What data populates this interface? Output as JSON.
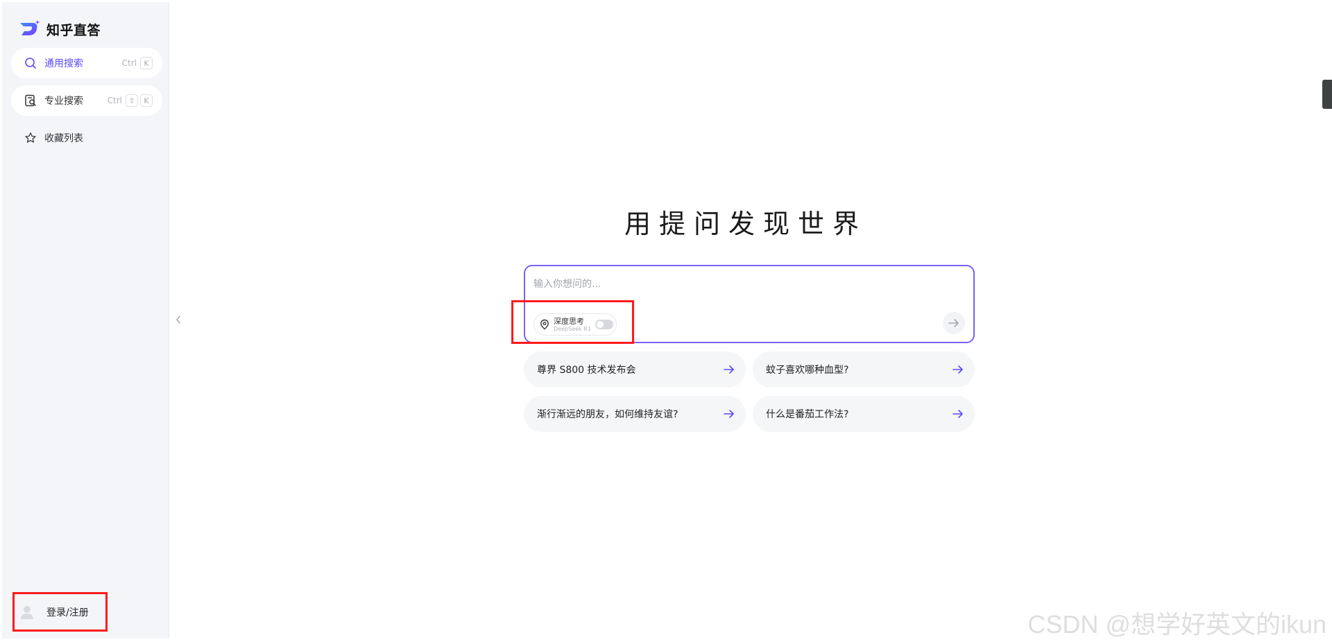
{
  "brand": {
    "name": "知乎直答"
  },
  "sidebar": {
    "items": [
      {
        "label": "通用搜索",
        "shortcut": [
          "Ctrl",
          "K"
        ],
        "icon": "search-icon",
        "active": true
      },
      {
        "label": "专业搜索",
        "shortcut": [
          "Ctrl",
          "⇧",
          "K"
        ],
        "icon": "doc-search-icon",
        "active": false
      },
      {
        "label": "收藏列表",
        "icon": "star-icon",
        "active": false
      }
    ],
    "login_label": "登录/注册"
  },
  "main": {
    "headline": "用提问发现世界",
    "input_placeholder": "输入你想问的...",
    "deep_think": {
      "title": "深度思考",
      "subtitle": "DeepSeek R1",
      "enabled": false
    },
    "suggestions": [
      "尊界 S800 技术发布会",
      "蚊子喜欢哪种血型?",
      "渐行渐远的朋友，如何维持友谊?",
      "什么是番茄工作法?"
    ]
  },
  "watermark": "CSDN @想学好英文的ikun",
  "colors": {
    "accent": "#5a4af4",
    "highlight": "#ff1a1a"
  }
}
